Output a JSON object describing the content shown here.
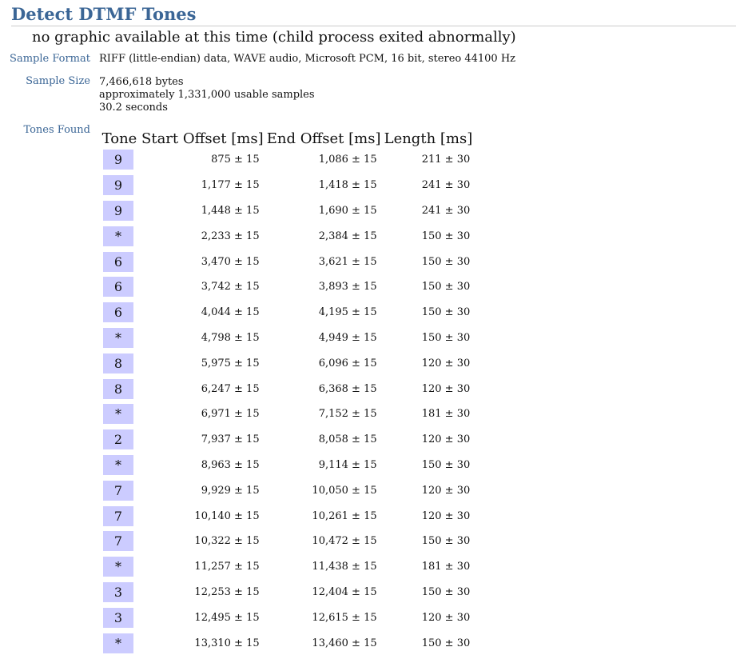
{
  "title": "Detect DTMF Tones",
  "no_graphic_message": "no graphic available at this time (child process exited abnormally)",
  "sample_format": {
    "label": "Sample Format",
    "value": "RIFF (little-endian) data, WAVE audio, Microsoft PCM, 16 bit, stereo 44100 Hz"
  },
  "sample_size": {
    "label": "Sample Size",
    "bytes": "7,466,618 bytes",
    "samples": "approximately 1,331,000 usable samples",
    "seconds": "30.2 seconds"
  },
  "tones_found": {
    "label": "Tones Found",
    "headers": [
      "Tone",
      "Start Offset [ms]",
      "End Offset [ms]",
      "Length [ms]"
    ],
    "rows": [
      {
        "tone": "9",
        "start": "875 ± 15",
        "end": "1,086 ± 15",
        "length": "211 ± 30"
      },
      {
        "tone": "9",
        "start": "1,177 ± 15",
        "end": "1,418 ± 15",
        "length": "241 ± 30"
      },
      {
        "tone": "9",
        "start": "1,448 ± 15",
        "end": "1,690 ± 15",
        "length": "241 ± 30"
      },
      {
        "tone": "*",
        "start": "2,233 ± 15",
        "end": "2,384 ± 15",
        "length": "150 ± 30"
      },
      {
        "tone": "6",
        "start": "3,470 ± 15",
        "end": "3,621 ± 15",
        "length": "150 ± 30"
      },
      {
        "tone": "6",
        "start": "3,742 ± 15",
        "end": "3,893 ± 15",
        "length": "150 ± 30"
      },
      {
        "tone": "6",
        "start": "4,044 ± 15",
        "end": "4,195 ± 15",
        "length": "150 ± 30"
      },
      {
        "tone": "*",
        "start": "4,798 ± 15",
        "end": "4,949 ± 15",
        "length": "150 ± 30"
      },
      {
        "tone": "8",
        "start": "5,975 ± 15",
        "end": "6,096 ± 15",
        "length": "120 ± 30"
      },
      {
        "tone": "8",
        "start": "6,247 ± 15",
        "end": "6,368 ± 15",
        "length": "120 ± 30"
      },
      {
        "tone": "*",
        "start": "6,971 ± 15",
        "end": "7,152 ± 15",
        "length": "181 ± 30"
      },
      {
        "tone": "2",
        "start": "7,937 ± 15",
        "end": "8,058 ± 15",
        "length": "120 ± 30"
      },
      {
        "tone": "*",
        "start": "8,963 ± 15",
        "end": "9,114 ± 15",
        "length": "150 ± 30"
      },
      {
        "tone": "7",
        "start": "9,929 ± 15",
        "end": "10,050 ± 15",
        "length": "120 ± 30"
      },
      {
        "tone": "7",
        "start": "10,140 ± 15",
        "end": "10,261 ± 15",
        "length": "120 ± 30"
      },
      {
        "tone": "7",
        "start": "10,322 ± 15",
        "end": "10,472 ± 15",
        "length": "150 ± 30"
      },
      {
        "tone": "*",
        "start": "11,257 ± 15",
        "end": "11,438 ± 15",
        "length": "181 ± 30"
      },
      {
        "tone": "3",
        "start": "12,253 ± 15",
        "end": "12,404 ± 15",
        "length": "150 ± 30"
      },
      {
        "tone": "3",
        "start": "12,495 ± 15",
        "end": "12,615 ± 15",
        "length": "120 ± 30"
      },
      {
        "tone": "*",
        "start": "13,310 ± 15",
        "end": "13,460 ± 15",
        "length": "150 ± 30"
      }
    ]
  },
  "colors": {
    "heading_blue": "#3b6696",
    "tone_box_bg": "#ccccff"
  }
}
